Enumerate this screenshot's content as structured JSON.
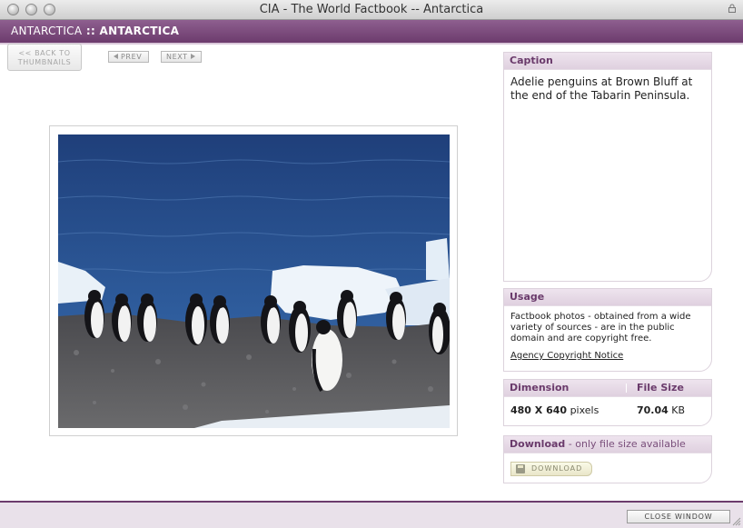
{
  "window": {
    "title": "CIA - The World Factbook -- Antarctica"
  },
  "header": {
    "region": "ANTARCTICA",
    "separator": " :: ",
    "country": "ANTARCTICA"
  },
  "nav": {
    "back_line1": "<< BACK TO",
    "back_line2": "THUMBNAILS",
    "prev_label": "PREV",
    "next_label": "NEXT"
  },
  "photo": {
    "description_icon": "photo-of-penguins"
  },
  "caption": {
    "heading": "Caption",
    "text": "Adelie penguins at Brown Bluff at the end of the Tabarin Peninsula."
  },
  "usage": {
    "heading": "Usage",
    "text": "Factbook photos - obtained from a wide variety of sources - are in the public domain and are copyright free.",
    "link": "Agency Copyright Notice"
  },
  "dimension": {
    "heading": "Dimension",
    "size_heading": "File Size",
    "value": "480 X 640",
    "value_unit": " pixels",
    "size": "70.04",
    "size_unit": " KB"
  },
  "download": {
    "heading": "Download",
    "note": " - only file size available",
    "button": "DOWNLOAD"
  },
  "footer": {
    "close_label": "CLOSE WINDOW"
  },
  "colors": {
    "brand_purple": "#6c3b6d",
    "panel_header": "#e6dae6"
  }
}
